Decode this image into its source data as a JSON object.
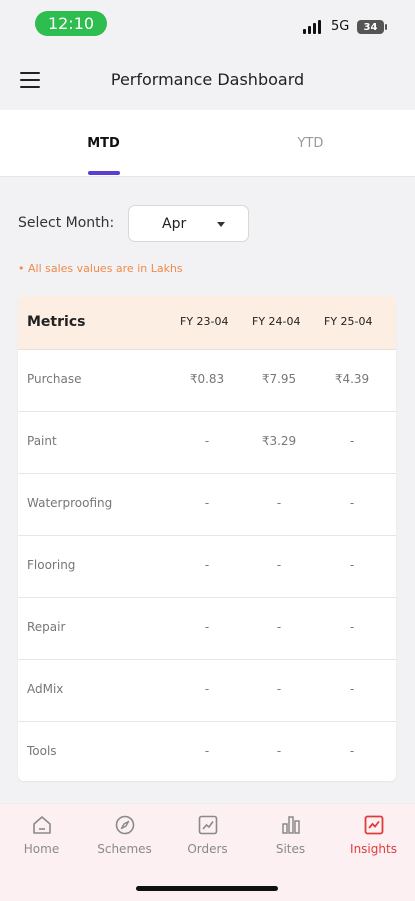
{
  "status": {
    "time": "12:10",
    "network": "5G",
    "battery": "34"
  },
  "header": {
    "title": "Performance Dashboard"
  },
  "tabs": [
    {
      "label": "MTD"
    },
    {
      "label": "YTD"
    }
  ],
  "filter": {
    "label": "Select Month:",
    "value": "Apr"
  },
  "note": "• All sales values are in Lakhs",
  "table": {
    "headers": [
      "Metrics",
      "FY 23-04",
      "FY 24-04",
      "FY 25-04"
    ],
    "rows": [
      {
        "name": "Purchase",
        "v1": "₹0.83",
        "v2": "₹7.95",
        "v3": "₹4.39"
      },
      {
        "name": "Paint",
        "v1": "-",
        "v2": "₹3.29",
        "v3": "-"
      },
      {
        "name": "Waterproofing",
        "v1": "-",
        "v2": "-",
        "v3": "-"
      },
      {
        "name": "Flooring",
        "v1": "-",
        "v2": "-",
        "v3": "-"
      },
      {
        "name": "Repair",
        "v1": "-",
        "v2": "-",
        "v3": "-"
      },
      {
        "name": "AdMix",
        "v1": "-",
        "v2": "-",
        "v3": "-"
      },
      {
        "name": "Tools",
        "v1": "-",
        "v2": "-",
        "v3": "-"
      }
    ]
  },
  "nav": [
    {
      "label": "Home",
      "icon": "home-icon"
    },
    {
      "label": "Schemes",
      "icon": "compass-icon"
    },
    {
      "label": "Orders",
      "icon": "trend-chart-icon"
    },
    {
      "label": "Sites",
      "icon": "bar-chart-icon"
    },
    {
      "label": "Insights",
      "icon": "insights-icon"
    }
  ],
  "colors": {
    "accent": "#5a3fd0",
    "active_nav": "#e03b3b",
    "note": "#f08a4b",
    "table_header_bg": "#fdeee4"
  }
}
